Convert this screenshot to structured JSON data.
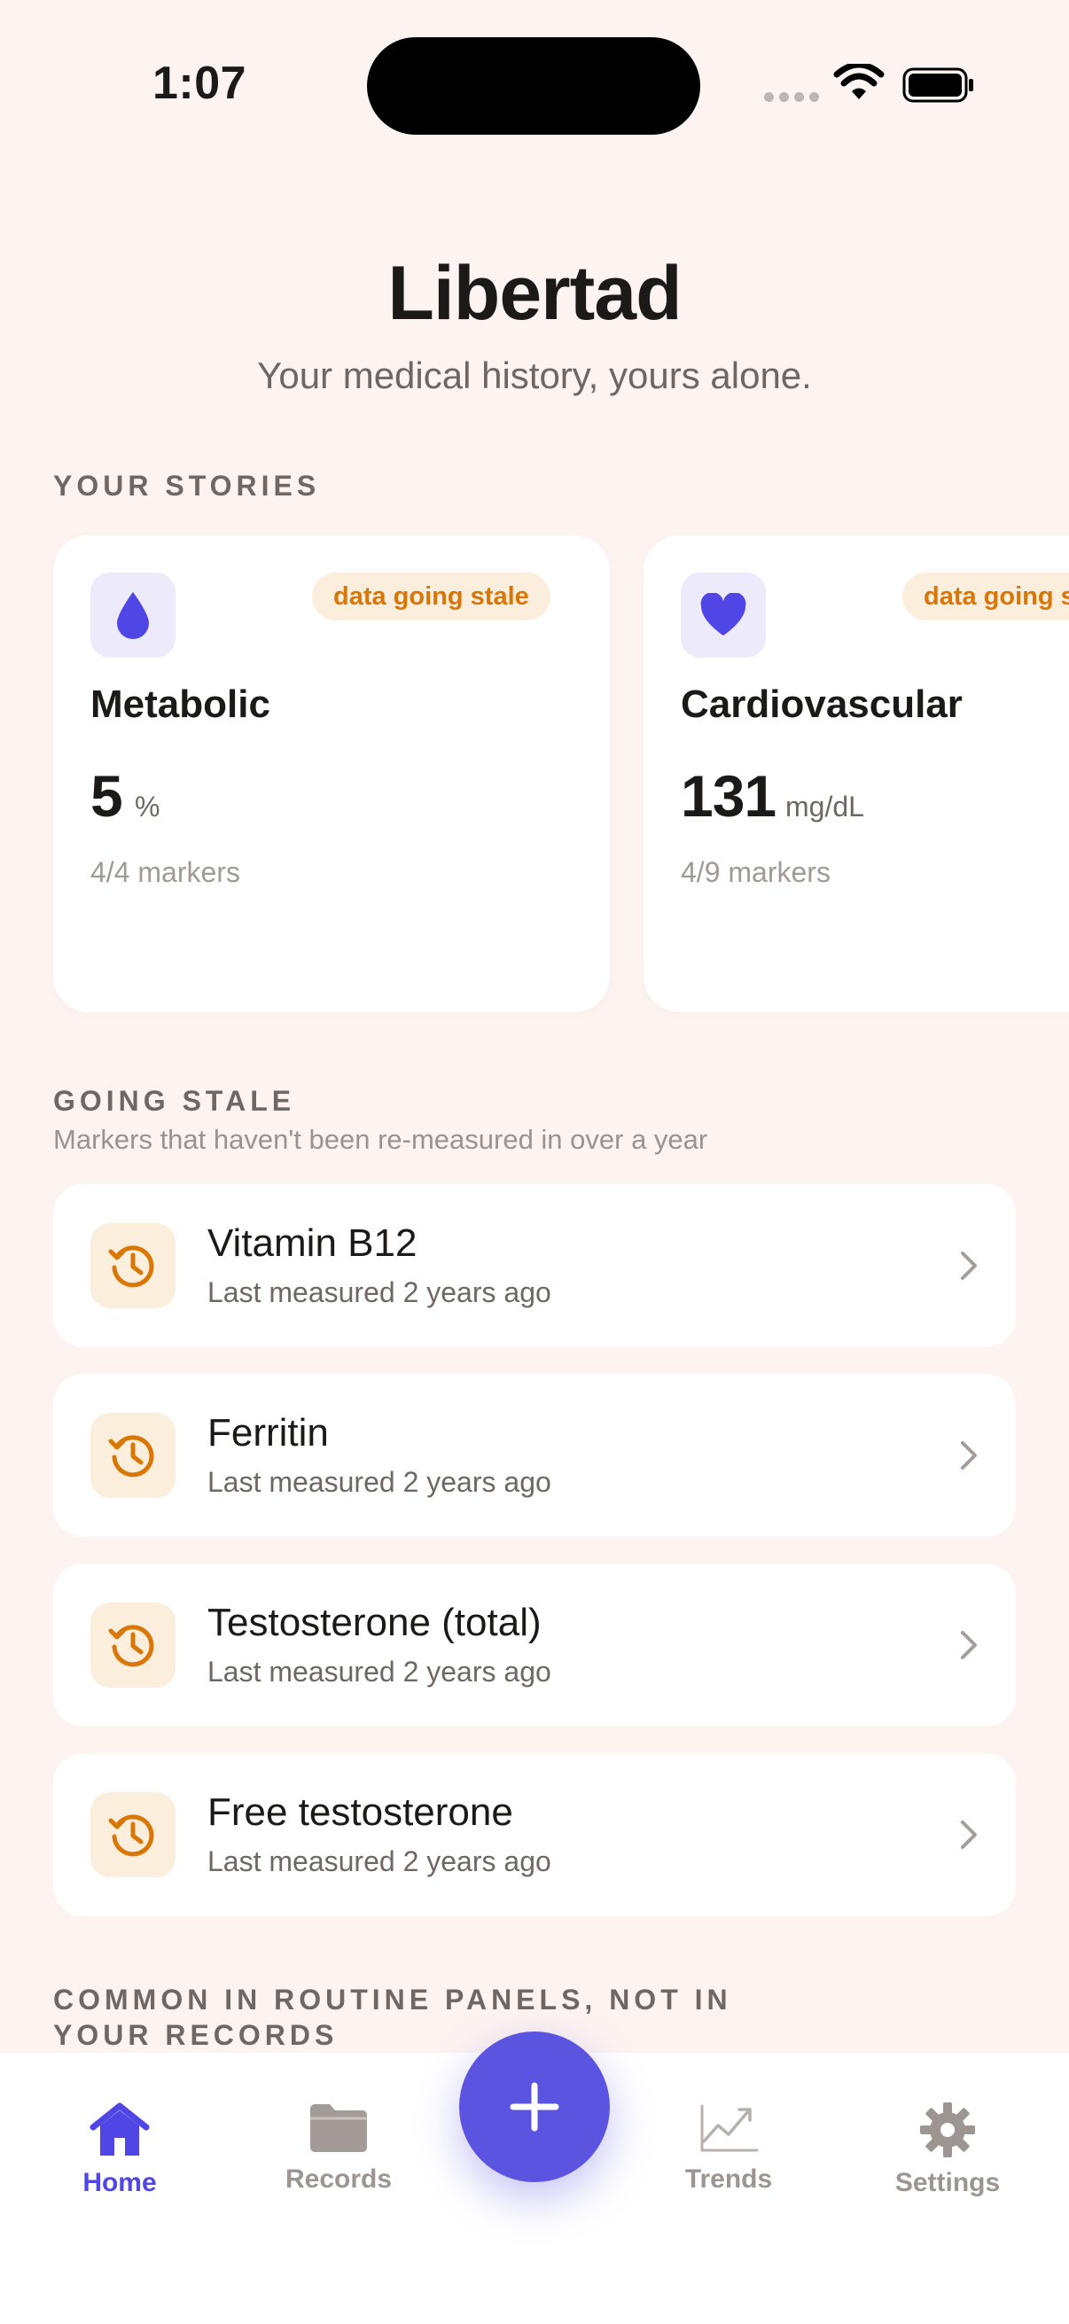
{
  "status_bar": {
    "time": "1:07"
  },
  "header": {
    "title": "Libertad",
    "subtitle": "Your medical history, yours alone."
  },
  "stories": {
    "section_label": "YOUR STORIES",
    "cards": [
      {
        "icon": "drop-icon",
        "badge": "data going stale",
        "name": "Metabolic",
        "value": "5",
        "unit": "%",
        "markers": "4/4 markers"
      },
      {
        "icon": "heart-icon",
        "badge": "data going stale",
        "name": "Cardiovascular",
        "value": "131",
        "unit": "mg/dL",
        "markers": "4/9 markers"
      }
    ]
  },
  "going_stale": {
    "section_label": "GOING STALE",
    "description": "Markers that haven't been re-measured in over a year",
    "items": [
      {
        "icon": "history-clock-icon",
        "title": "Vitamin B12",
        "subtitle": "Last measured 2 years ago"
      },
      {
        "icon": "history-clock-icon",
        "title": "Ferritin",
        "subtitle": "Last measured 2 years ago"
      },
      {
        "icon": "history-clock-icon",
        "title": "Testosterone (total)",
        "subtitle": "Last measured 2 years ago"
      },
      {
        "icon": "history-clock-icon",
        "title": "Free testosterone",
        "subtitle": "Last measured 2 years ago"
      }
    ]
  },
  "common_panels": {
    "section_label_line1": "COMMON IN ROUTINE PANELS, NOT IN",
    "section_label_line2": "YOUR RECORDS"
  },
  "tab_bar": {
    "tabs": [
      {
        "label": "Home",
        "icon": "home-icon",
        "active": true
      },
      {
        "label": "Records",
        "icon": "folder-icon",
        "active": false
      },
      {
        "label": "Trends",
        "icon": "trend-chart-icon",
        "active": false
      },
      {
        "label": "Settings",
        "icon": "gear-icon",
        "active": false
      }
    ],
    "add_button_icon": "plus-icon"
  },
  "colors": {
    "background": "#FDF4F1",
    "accent": "#4F46E5",
    "stale": "#D97706",
    "stale_bg": "#FCEEDD"
  }
}
